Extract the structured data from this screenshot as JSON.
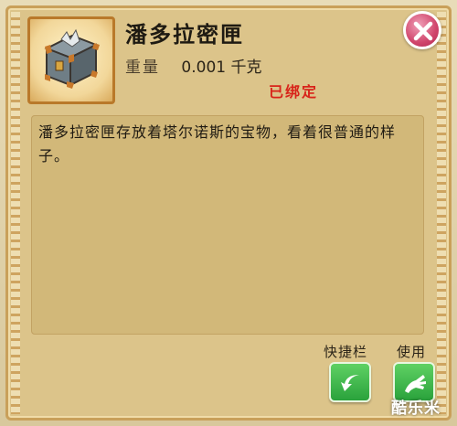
{
  "item": {
    "name": "潘多拉密匣",
    "weight_label": "重量",
    "weight_value": "0.001 千克",
    "status": "已绑定",
    "description": "潘多拉密匣存放着塔尔诺斯的宝物，看着很普通的样子。",
    "icon": "treasure-chest-icon"
  },
  "actions": {
    "shortcut_label": "快捷栏",
    "use_label": "使用",
    "shortcut_icon": "arrow-left-icon",
    "use_icon": "hand-use-icon"
  },
  "close_icon": "close-x-icon",
  "watermark": "酷乐米",
  "colors": {
    "status": "#d8241a",
    "close_button": "#d0456c",
    "action_button": "#3bb84b",
    "panel": "#dcc48a"
  }
}
